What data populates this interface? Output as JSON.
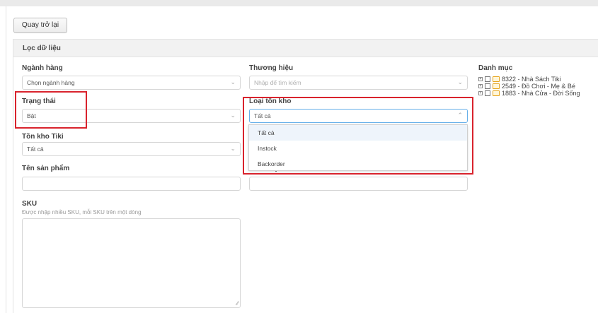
{
  "back_button": "Quay trở lại",
  "panel": {
    "title": "Lọc dữ liệu"
  },
  "filters": {
    "nganh_hang": {
      "label": "Ngành hàng",
      "value": "Chọn ngành hàng"
    },
    "thuong_hieu": {
      "label": "Thương hiệu",
      "placeholder": "Nhập để tìm kiếm"
    },
    "trang_thai": {
      "label": "Trạng thái",
      "value": "Bật"
    },
    "loai_ton_kho": {
      "label": "Loại tồn kho",
      "value": "Tất cả",
      "options": [
        "Tất cả",
        "Instock",
        "Backorder"
      ]
    },
    "ton_kho_tiki": {
      "label": "Tồn kho Tiki",
      "value": "Tất cả"
    },
    "ten_san_pham": {
      "label": "Tên sản phẩm",
      "value": ""
    },
    "ma_san_pham": {
      "label": "Mã sản phẩm",
      "value": ""
    },
    "sku": {
      "label": "SKU",
      "hint": "Được nhập nhiều SKU, mỗi SKU trên một dòng",
      "value": ""
    }
  },
  "danh_muc": {
    "label": "Danh mục",
    "items": [
      {
        "label": "8322 - Nhà Sách Tiki"
      },
      {
        "label": "2549 - Đồ Chơi - Mẹ & Bé"
      },
      {
        "label": "1883 - Nhà Cửa - Đời Sống"
      }
    ]
  },
  "colors": {
    "highlight": "#d9232d",
    "focus": "#66afe9",
    "folder": "#e6a31a"
  }
}
